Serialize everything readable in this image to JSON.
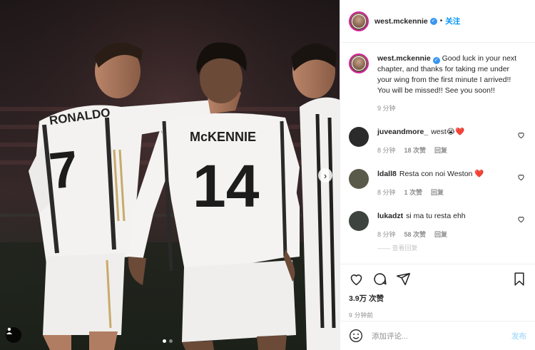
{
  "post": {
    "author": "west.mckennie",
    "follow_label": "关注",
    "caption": "Good luck in your next chapter, and thanks for taking me under your wing from the first minute I arrived!! You will be missed!! See you soon!!",
    "caption_time": "9 分钟",
    "jerseys": {
      "left_name": "RONALDO",
      "left_number": "7",
      "center_name": "McKENNIE",
      "center_number": "14"
    }
  },
  "comments": [
    {
      "user": "juveandmore_",
      "text": "west😭❤️",
      "time": "8 分钟",
      "likes": "18 次赞",
      "reply": "回复",
      "avatar_color": "#2b2b2b"
    },
    {
      "user": "ldall8",
      "text": "Resta con noi Weston ❤️",
      "time": "8 分钟",
      "likes": "1 次赞",
      "reply": "回复",
      "avatar_color": "#5a5a4a"
    },
    {
      "user": "lukadzt",
      "text": "si ma tu resta ehh",
      "time": "8 分钟",
      "likes": "58 次赞",
      "reply": "回复",
      "avatar_color": "#3d4440"
    }
  ],
  "more_replies": "—— 查看回复",
  "actions": {
    "like_count": "3.9万 次赞",
    "posted_time": "9 分钟前"
  },
  "composer": {
    "placeholder": "添加评论...",
    "post_label": "发布"
  },
  "icons": [
    "heart-icon",
    "comment-icon",
    "share-icon",
    "bookmark-icon",
    "emoji-icon",
    "verified-icon",
    "chevron-right-icon",
    "user-tag-icon"
  ],
  "colors": {
    "accent": "#0095f6",
    "verified": "#3897f0",
    "heart": "#ed4956",
    "post_disabled": "#b2dffc"
  }
}
